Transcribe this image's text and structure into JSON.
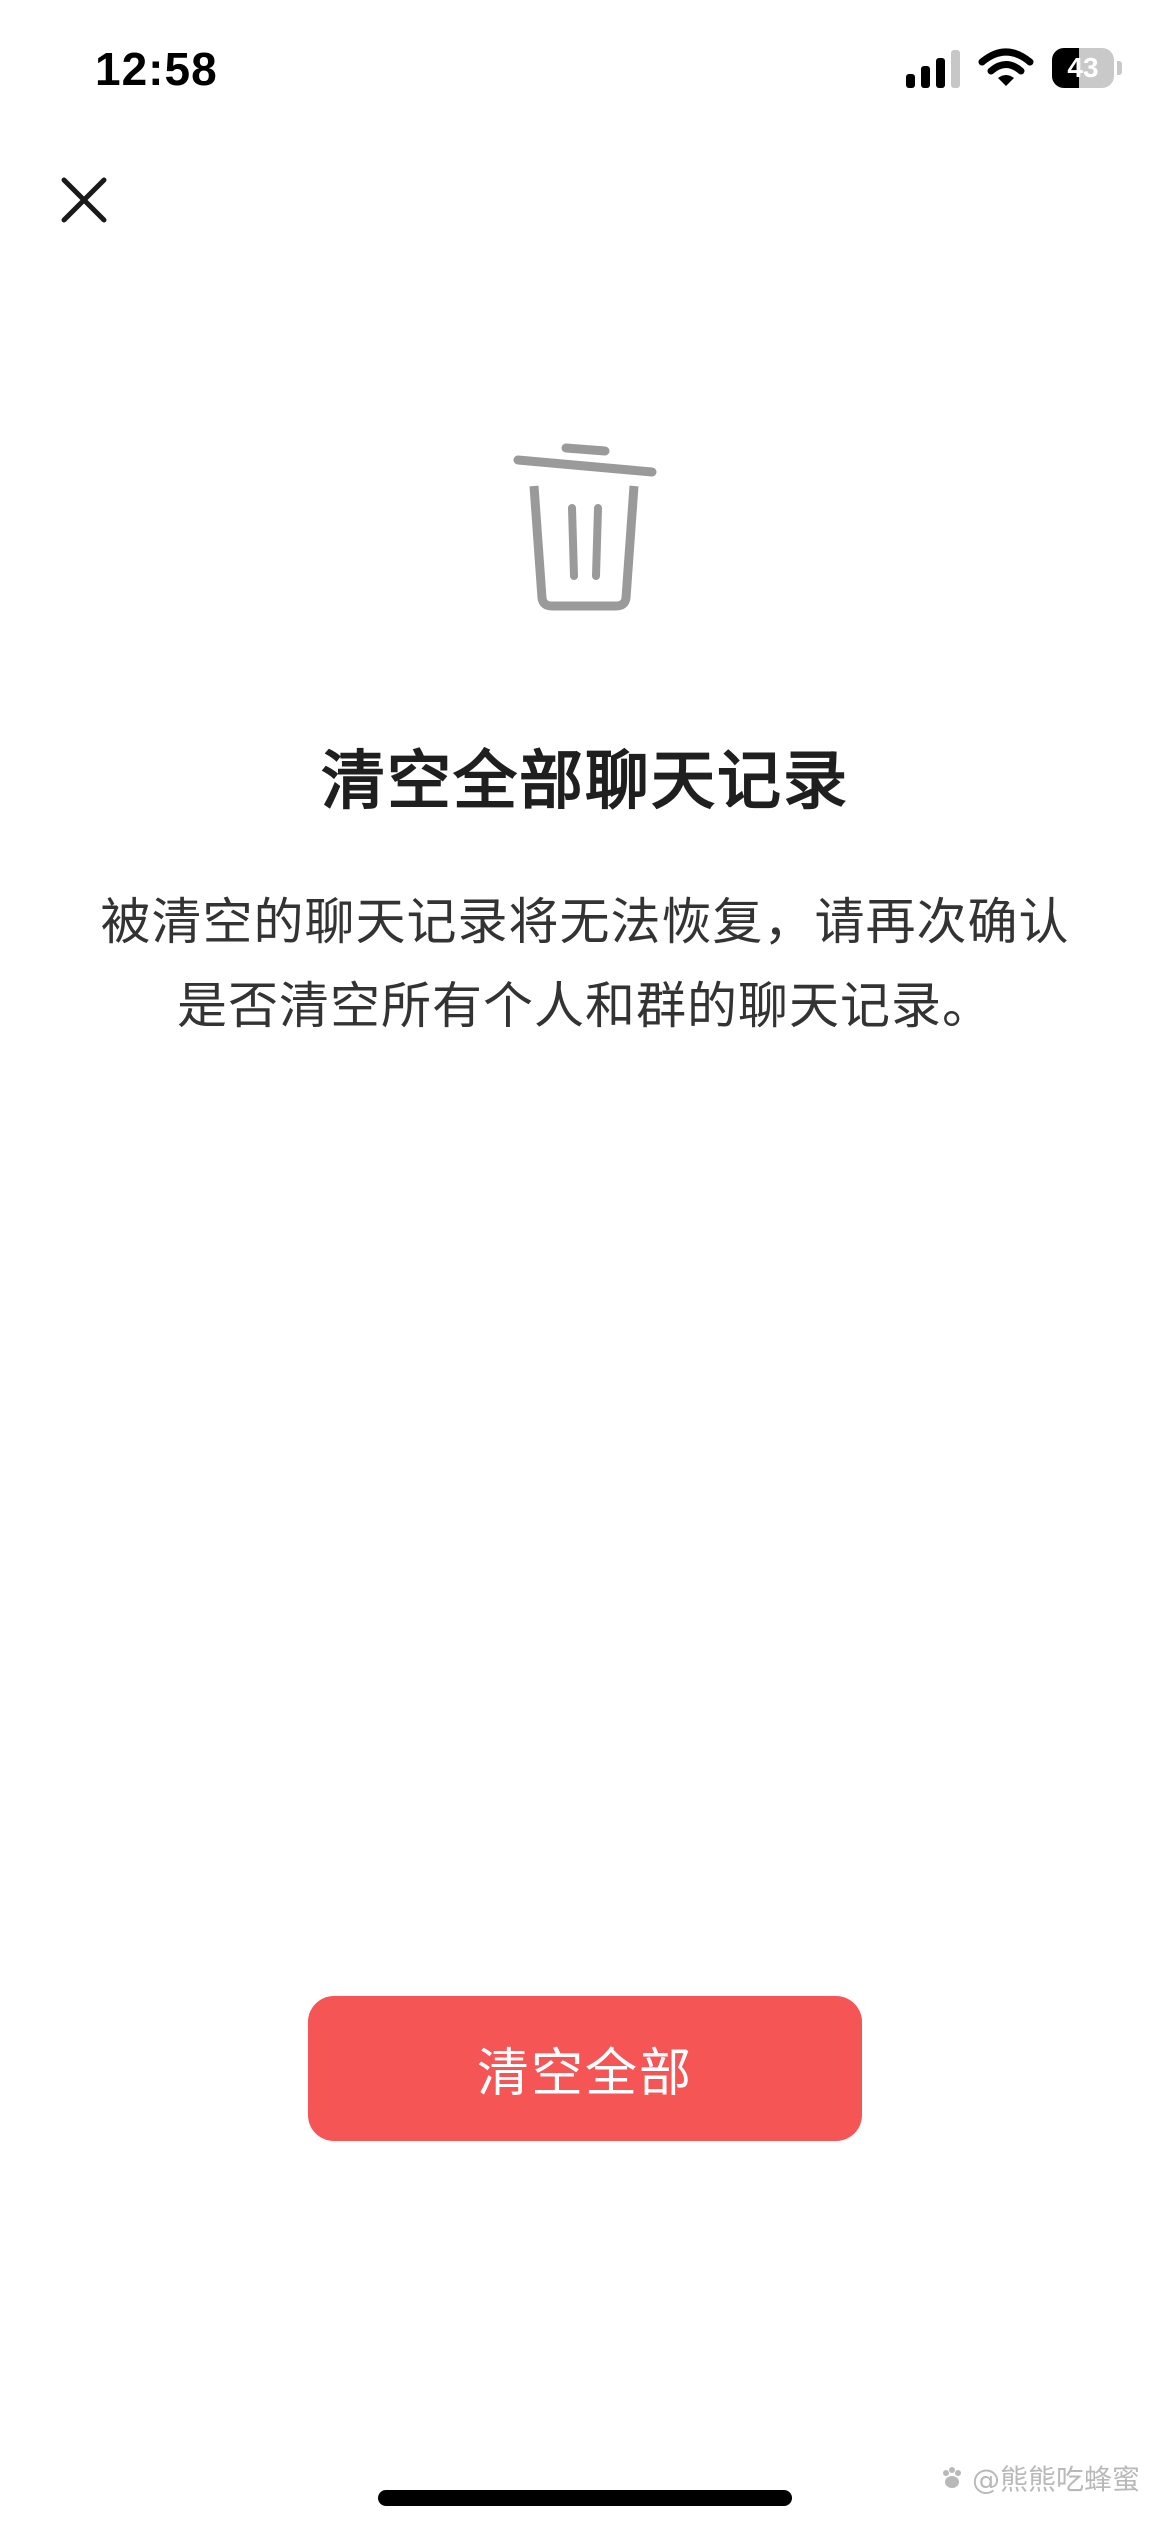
{
  "status_bar": {
    "time": "12:58",
    "battery_level": "43"
  },
  "dialog": {
    "title": "清空全部聊天记录",
    "description": "被清空的聊天记录将无法恢复，请再次确认是否清空所有个人和群的聊天记录。",
    "confirm_label": "清空全部"
  },
  "icons": {
    "close": "close-icon",
    "trash": "trash-icon",
    "signal": "signal-icon",
    "wifi": "wifi-icon",
    "battery": "battery-icon"
  },
  "watermark": {
    "text": "@熊熊吃蜂蜜"
  },
  "colors": {
    "accent": "#f65556",
    "title": "#1f1f1f",
    "text": "#333333",
    "icon_gray": "#9a9a9a"
  }
}
